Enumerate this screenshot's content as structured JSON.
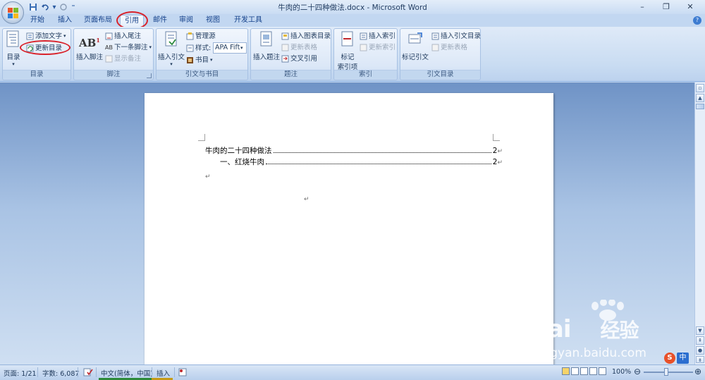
{
  "window": {
    "title": "牛肉的二十四种做法.docx - Microsoft Word"
  },
  "tabs": [
    {
      "label": "开始",
      "active": false
    },
    {
      "label": "插入",
      "active": false
    },
    {
      "label": "页面布局",
      "active": false
    },
    {
      "label": "引用",
      "active": true
    },
    {
      "label": "邮件",
      "active": false
    },
    {
      "label": "审阅",
      "active": false
    },
    {
      "label": "视图",
      "active": false
    },
    {
      "label": "开发工具",
      "active": false
    }
  ],
  "ribbon": {
    "toc": {
      "label": "目录",
      "big_button": "目录",
      "add_text": "添加文字",
      "update_toc": "更新目录"
    },
    "footnotes": {
      "label": "脚注",
      "insert_footnote": "插入脚注",
      "insert_endnote": "插入尾注",
      "next_footnote": "下一条脚注",
      "show_notes": "显示备注"
    },
    "citations": {
      "label": "引文与书目",
      "insert_citation": "插入引文",
      "manage_sources": "管理源",
      "style_label": "样式:",
      "style_value": "APA Fifth",
      "bibliography": "书目"
    },
    "captions": {
      "label": "题注",
      "insert_caption": "插入题注",
      "insert_table_of_figures": "插入图表目录",
      "update_table": "更新表格",
      "cross_reference": "交叉引用"
    },
    "index": {
      "label": "索引",
      "mark_entry_line1": "标记",
      "mark_entry_line2": "索引项",
      "insert_index": "插入索引",
      "update_index": "更新索引"
    },
    "toa": {
      "label": "引文目录",
      "mark_citation": "标记引文",
      "insert_toa": "插入引文目录",
      "update_table": "更新表格"
    }
  },
  "document": {
    "toc_entries": [
      {
        "text": "牛肉的二十四种做法",
        "page": "2"
      },
      {
        "text": "一、红烧牛肉",
        "page": "2"
      }
    ]
  },
  "statusbar": {
    "page": "页面: 1/21",
    "words": "字数: 6,087",
    "language": "中文(简体，中国)",
    "mode": "插入",
    "zoom": "100%"
  },
  "watermark": {
    "brand": "Bai",
    "brand_suffix": "经验",
    "url": "jingyan.baidu.com"
  },
  "ime": {
    "s": "S",
    "zh": "中"
  },
  "colors": {
    "annotation_red": "#d9222a",
    "ribbon_blue": "#c4d7ef"
  }
}
